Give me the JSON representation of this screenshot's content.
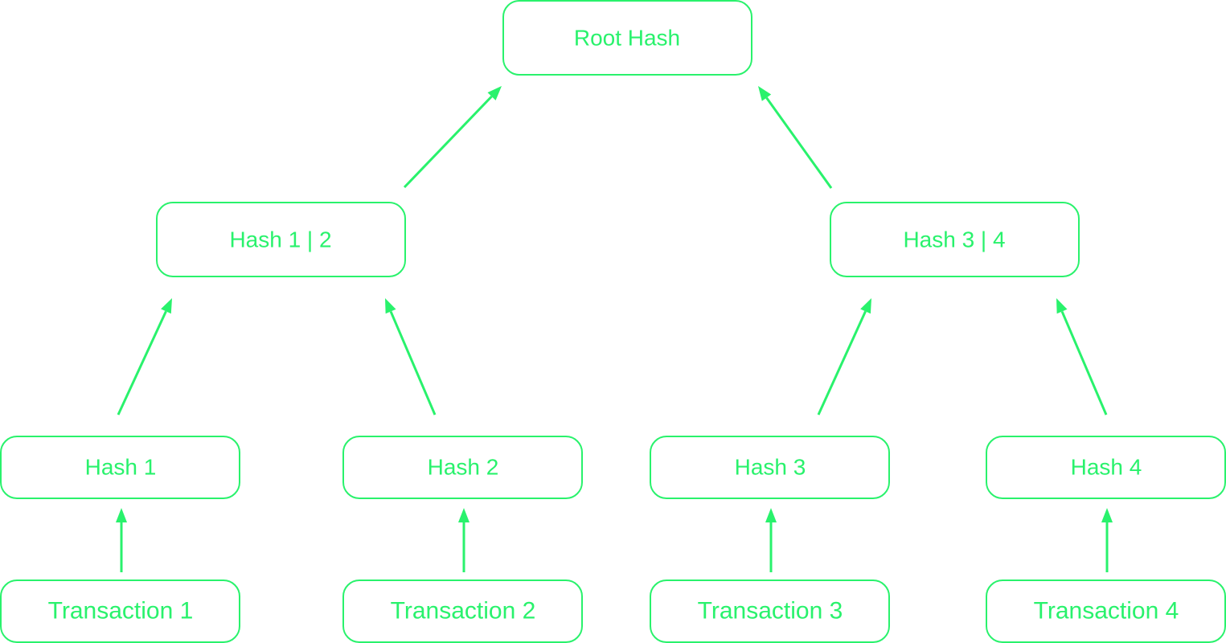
{
  "diagram": {
    "accent_color": "#29f26c",
    "nodes": {
      "root": "Root Hash",
      "hash12": "Hash 1 | 2",
      "hash34": "Hash 3 | 4",
      "hash1": "Hash 1",
      "hash2": "Hash 2",
      "hash3": "Hash 3",
      "hash4": "Hash 4",
      "tx1": "Transaction 1",
      "tx2": "Transaction 2",
      "tx3": "Transaction 3",
      "tx4": "Transaction 4"
    },
    "edges": [
      [
        "tx1",
        "hash1"
      ],
      [
        "tx2",
        "hash2"
      ],
      [
        "tx3",
        "hash3"
      ],
      [
        "tx4",
        "hash4"
      ],
      [
        "hash1",
        "hash12"
      ],
      [
        "hash2",
        "hash12"
      ],
      [
        "hash3",
        "hash34"
      ],
      [
        "hash4",
        "hash34"
      ],
      [
        "hash12",
        "root"
      ],
      [
        "hash34",
        "root"
      ]
    ]
  }
}
